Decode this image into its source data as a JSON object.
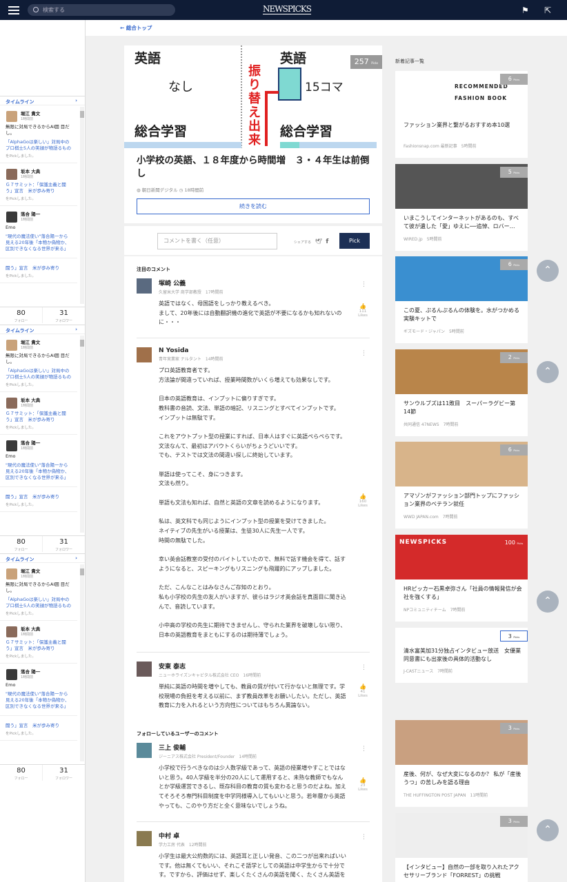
{
  "header": {
    "search_placeholder": "検索する",
    "logo": "NEWSPICKS"
  },
  "breadcrumb": "総合トップ",
  "timeline": {
    "heading": "タイムライン",
    "items": [
      {
        "name": "堀江 貴文",
        "time": "1時間前",
        "text": "無限に対局できるからAI囲  目だし。",
        "link": "「AlphaGoは楽しい」対局中のプロ棋士5人の笑顔が物語るもの",
        "sub": "をPickしました。"
      },
      {
        "name": "坂本 大典",
        "time": "1時間前",
        "text": "",
        "link": "Ｇ７サミット：「保護主義と闘う」宣言　米が歩み寄り",
        "sub": "をPickしました。"
      },
      {
        "name": "落合 陽一",
        "time": "1時間前",
        "text": "Emo",
        "link": "\"現代の魔法使い\"落合陽一から見える20年後「本物か偽物か、区別できなくなる世界が来る」",
        "sub": ""
      }
    ],
    "partial": {
      "link": "闘う」宣言　米が歩み寄り",
      "sub": "をPickしました。"
    },
    "follow": {
      "count": "80",
      "label": "フォロー"
    },
    "follower": {
      "count": "31",
      "label": "フォロワー"
    }
  },
  "article": {
    "picks": "257",
    "picks_unit": "Picks",
    "title": "小学校の英語、１８年度から時間増　３・４年生は前倒し",
    "source": "朝日新聞デジタル",
    "time": "18時間前",
    "read_more": "続きを読む",
    "hero": {
      "left_top": "英語",
      "left_mid": "なし",
      "left_bottom": "総合学習",
      "right_top": "英語",
      "right_mid": "15コマ",
      "right_bottom": "総合学習",
      "vertical": "振り替え出来"
    }
  },
  "composer": {
    "placeholder": "コメントを書く（任意）",
    "share": "シェアする",
    "pick": "Pick"
  },
  "sections": {
    "featured": "注目のコメント",
    "following": "フォローしているユーザーのコメント"
  },
  "comments": [
    {
      "name": "塚崎 公義",
      "role": "久留米大学 商学部教授　17時間前",
      "body": "英語ではなく、母国語をしっかり教えるべき。\nまして、20年後には自動翻訳機の進化で英語が不要になるかも知れないのに・・・",
      "likes": "111",
      "likes_label": "Likes"
    },
    {
      "name": "N Yosida",
      "role": "青年実業家 ナルタント　14時間前",
      "body": "プロ英語教育者です。\n方法論が間違っていれば、授業時間数がいくら増えても効果なしです。\n\n日本の英語教育は、インプットに偏りすぎです。\n教科書の音読、文法、単語の暗記、リスニングとすべてインプットです。\nインプットは無駄です。\n\nこれをアウトプット型の授業にすれば、日本人はすぐに英語ぺらぺらです。\n文法なんて、最初はアバウトくらいがちょうどいいです。\nでも、テストでは文法の間違い探しに終始しています。\n\n単語は使ってこそ、身につきます。\n文法も然り。\n\n単語も文法も知れば、自然と英語の文章を読めるようになります。\n\n私は、英文科でも同じようにインプット型の授業を受けてきました。\nネイティブの先生がいる授業は、生徒30人に先生一人です。\n時間の無駄でした。\n\n幸い英会話教室の受付のバイトしていたので、無料で話す機会を得て、話すようになると、スピーキングもリスニングも飛躍的にアップしました。\n\nただ、こんなことはみなさんご存知のとおり。\n私も小学校の先生の友人がいますが、彼らはラジオ英会話を真面目に聞き込んで、音読しています。\n\n小中高の学校の先生に期待できませんし、守られた業界を破壊しない限り、日本の英語教育をまともにするのは期待薄でしょう。",
      "likes": "160",
      "likes_label": "Likes"
    },
    {
      "name": "安東 泰志",
      "role": "ニューホライズンキャピタル株式会社 CEO　16時間前",
      "body": "単純に英語の時間を増やしても、教員の質が付いて行かないと無理です。学校現場の負担を考える以前に、まず教員改革をお願いしたい。ただし、英語教育に力を入れるという方向性についてはもちろん異論ない。",
      "likes": "41",
      "likes_label": "Likes"
    },
    {
      "name": "三上 俊輔",
      "role": "ジーニアス株式会社 President/Founder　14時間前",
      "body": "小学校で行うべきなのは少人数学級であって、英語の授業増やすことではないと思う。40人学級を半分の20人にして運用すると、未熟な教師でもなんとか学級運営できるし、既存科目の教育の質も変わると思うのだよね。加えてそろそろ専門科目制度を中学同様導入してもいいと思う。若年層から英語やっても、このやり方だと全く意味ないでしょうね。",
      "likes": "23",
      "likes_label": "Likes"
    },
    {
      "name": "中村 卓",
      "role": "学力工房 代表　12時間前",
      "body": "小学生は最大公約数的には、英語耳と正しい発音、この二つが出来ればいいです。他は無くてもいい、それこそ語学としての英語は中学生からで十分です。ですから、評価はせず、楽しくたくさんの英語を聞く、たくさん英語を",
      "likes": "",
      "likes_label": ""
    }
  ],
  "right": {
    "title": "新着記事一覧",
    "items": [
      {
        "title": "ファッション業界と繋がるおすすめ本10選",
        "source": "Fashionsnap.com 最新記事",
        "time": "5時間前",
        "picks": "6",
        "img_text": "RECOMMENDED FASHION BOOK",
        "color": "#ffffff"
      },
      {
        "title": "いまこうしてインターネットがあるのも、すべて彼が遺した「愛」ゆえに──追悼、ロバー…",
        "source": "WIRED.jp",
        "time": "5時間前",
        "picks": "5",
        "img_text": "",
        "color": "#555555"
      },
      {
        "title": "この夏、ぷるんぷるんの体験を。水がつかめる実験キットで",
        "source": "ギズモード・ジャパン",
        "time": "5時間前",
        "picks": "6",
        "img_text": "",
        "color": "#3a8fd0"
      },
      {
        "title": "サンウルブズは11敗目　スーパーラグビー第14節",
        "source": "共同通信 47NEWS",
        "time": "7時間前",
        "picks": "2",
        "img_text": "",
        "color": "#b9854a"
      },
      {
        "title": "アマゾンがファッション部門トップにファッション業界のベテラン就任",
        "source": "WWD JAPAN.com",
        "time": "7時間前",
        "picks": "6",
        "img_text": "",
        "color": "#d8b48a"
      },
      {
        "title": "HRピッカー石黒卓弥さん「社員の情報発信が会社を強くする」",
        "source": "NPコミュニティチーム",
        "time": "7時間前",
        "picks": "100",
        "img_text": "NEWSPICKS",
        "color": "#d42a2a"
      },
      {
        "title": "清水富美加31分独占インタビュー放送　女優業同意書にも出家後の具体的活動なし",
        "source": "J-CASTニュース",
        "time": "7時間前",
        "picks": "3",
        "img_text": "",
        "color": ""
      },
      {
        "title": "産後、何が、なぜ大変になるのか？ 私が「産後うつ」の苦しみを語る理由",
        "source": "THE HUFFINGTON POST JAPAN",
        "time": "11時間前",
        "picks": "3",
        "img_text": "",
        "color": "#c9a080"
      },
      {
        "title": "【インタビュー】自然の一部を取り入れたアクセサリーブランド「FORREST」の挑戦",
        "source": "Fashionsnap.com 最新記事",
        "time": "11時間前",
        "picks": "3",
        "img_text": "",
        "color": "#eeeeee"
      }
    ]
  }
}
